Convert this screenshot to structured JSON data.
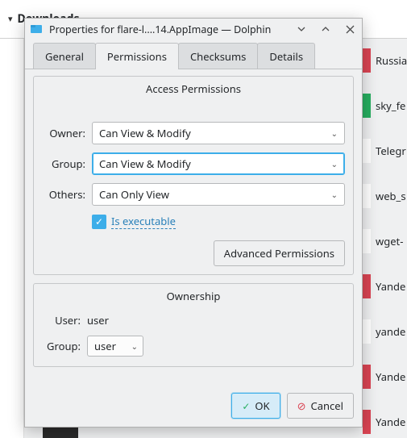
{
  "background": {
    "header": "Downloads",
    "items": [
      {
        "color": "#da4453",
        "label": "Russia"
      },
      {
        "color": "#27ae60",
        "label": "sky_fe"
      },
      {
        "color": "#ffffff",
        "label": "Telegr"
      },
      {
        "color": "#ffffff",
        "label": "web_s"
      },
      {
        "color": "#ffffff",
        "label": "wget-"
      },
      {
        "color": "#da4453",
        "label": "Yande"
      },
      {
        "color": "#ffffff",
        "label": "yande"
      },
      {
        "color": "#da4453",
        "label": "Yande"
      },
      {
        "color": "#da4453",
        "label": "Yande"
      }
    ]
  },
  "dialog": {
    "title": "Properties for flare-l....14.AppImage — Dolphin",
    "tabs": {
      "general": "General",
      "permissions": "Permissions",
      "checksums": "Checksums",
      "details": "Details"
    },
    "access": {
      "legend": "Access Permissions",
      "owner_label": "Owner:",
      "owner_value": "Can View & Modify",
      "group_label": "Group:",
      "group_value": "Can View & Modify",
      "others_label": "Others:",
      "others_value": "Can Only View",
      "executable_label": "Is executable",
      "advanced": "Advanced Permissions"
    },
    "ownership": {
      "legend": "Ownership",
      "user_label": "User:",
      "user_value": "user",
      "group_label": "Group:",
      "group_value": "user"
    },
    "buttons": {
      "ok": "OK",
      "cancel": "Cancel"
    }
  }
}
